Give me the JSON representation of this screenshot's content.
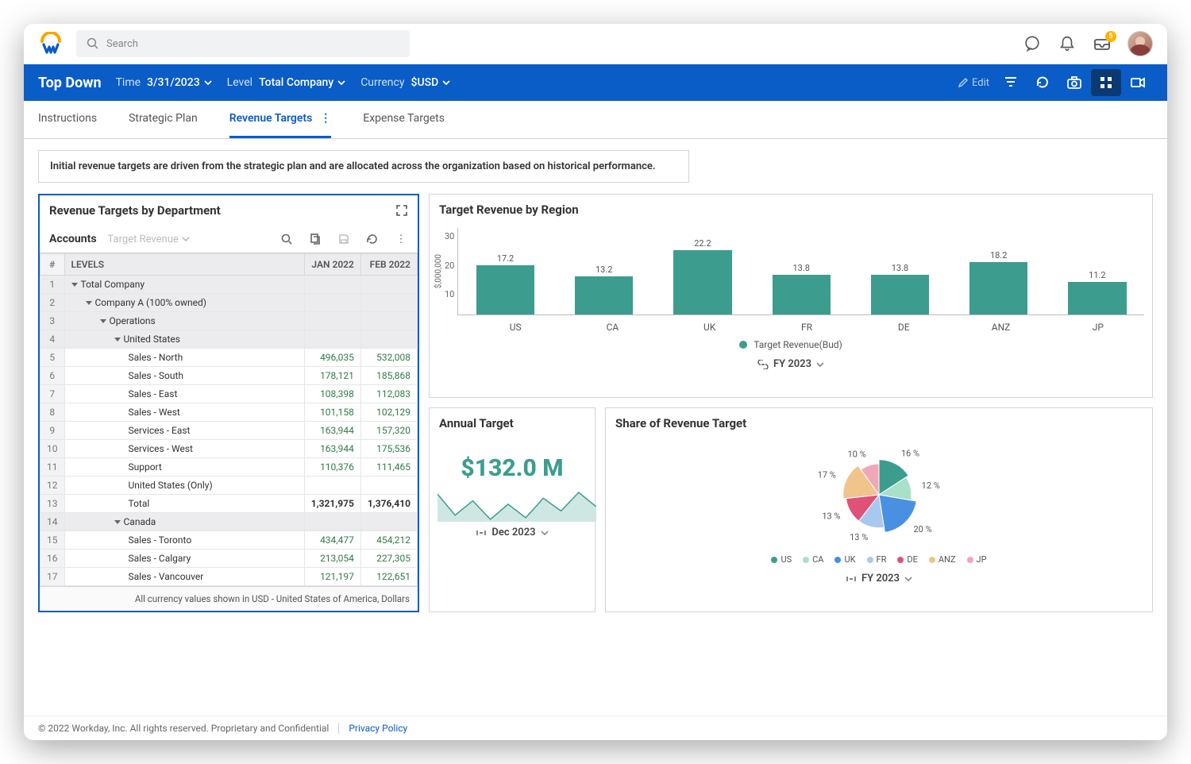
{
  "search_placeholder": "Search",
  "inbox_badge": "5",
  "bluebar": {
    "title": "Top Down",
    "time_label": "Time",
    "time_value": "3/31/2023",
    "level_label": "Level",
    "level_value": "Total Company",
    "currency_label": "Currency",
    "currency_value": "$USD",
    "edit_label": "Edit"
  },
  "tabs": {
    "instructions": "Instructions",
    "strategic_plan": "Strategic Plan",
    "revenue_targets": "Revenue Targets",
    "expense_targets": "Expense Targets"
  },
  "banner": "Initial revenue targets are driven from the strategic plan and are allocated across the organization based on historical performance.",
  "table": {
    "title": "Revenue Targets by Department",
    "accounts_label": "Accounts",
    "select_label": "Target Revenue",
    "col_num": "#",
    "col_levels": "LEVELS",
    "col_jan": "JAN 2022",
    "col_feb": "FEB 2022",
    "rows": [
      {
        "n": "1",
        "level": "Total Company",
        "indent": 0,
        "exp": true,
        "grey": true,
        "jan": "",
        "feb": ""
      },
      {
        "n": "2",
        "level": "Company A (100% owned)",
        "indent": 1,
        "exp": true,
        "grey": true,
        "jan": "",
        "feb": ""
      },
      {
        "n": "3",
        "level": "Operations",
        "indent": 2,
        "exp": true,
        "grey": true,
        "jan": "",
        "feb": ""
      },
      {
        "n": "4",
        "level": "United States",
        "indent": 3,
        "exp": true,
        "grey": true,
        "jan": "",
        "feb": ""
      },
      {
        "n": "5",
        "level": "Sales - North",
        "indent": 4,
        "jan": "496,035",
        "feb": "532,008"
      },
      {
        "n": "6",
        "level": "Sales - South",
        "indent": 4,
        "jan": "178,121",
        "feb": "185,868"
      },
      {
        "n": "7",
        "level": "Sales - East",
        "indent": 4,
        "jan": "108,398",
        "feb": "112,083"
      },
      {
        "n": "8",
        "level": "Sales - West",
        "indent": 4,
        "jan": "101,158",
        "feb": "102,129"
      },
      {
        "n": "9",
        "level": "Services - East",
        "indent": 4,
        "jan": "163,944",
        "feb": "157,320"
      },
      {
        "n": "10",
        "level": "Services - West",
        "indent": 4,
        "jan": "163,944",
        "feb": "175,536"
      },
      {
        "n": "11",
        "level": "Support",
        "indent": 4,
        "jan": "110,376",
        "feb": "111,465"
      },
      {
        "n": "12",
        "level": "United States (Only)",
        "indent": 4,
        "jan": "",
        "feb": ""
      },
      {
        "n": "13",
        "level": "Total",
        "indent": 4,
        "jan": "1,321,975",
        "feb": "1,376,410",
        "bold": true
      },
      {
        "n": "14",
        "level": "Canada",
        "indent": 3,
        "exp": true,
        "grey": true,
        "jan": "",
        "feb": ""
      },
      {
        "n": "15",
        "level": "Sales - Toronto",
        "indent": 4,
        "jan": "434,477",
        "feb": "454,212"
      },
      {
        "n": "16",
        "level": "Sales - Calgary",
        "indent": 4,
        "jan": "213,054",
        "feb": "227,305"
      },
      {
        "n": "17",
        "level": "Sales - Vancouver",
        "indent": 4,
        "jan": "121,197",
        "feb": "122,651"
      }
    ],
    "footer": "All currency values shown in USD - United States of America, Dollars"
  },
  "bar_card": {
    "title": "Target Revenue by Region",
    "y_title": "$,000,000",
    "legend": "Target Revenue(Bud)",
    "period": "FY 2023"
  },
  "annual": {
    "title": "Annual Target",
    "value": "$132.0 M",
    "period": "Dec 2023"
  },
  "pie_card": {
    "title": "Share of Revenue Target",
    "period": "FY 2023"
  },
  "footer": {
    "copyright": "© 2022 Workday, Inc. All rights reserved. Proprietary and Confidential",
    "privacy": "Privacy Policy"
  },
  "chart_data": [
    {
      "type": "bar",
      "title": "Target Revenue by Region",
      "ylabel": "$,000,000",
      "ylim": [
        0,
        30
      ],
      "yticks": [
        10,
        20,
        30
      ],
      "categories": [
        "US",
        "CA",
        "UK",
        "FR",
        "DE",
        "ANZ",
        "JP"
      ],
      "series": [
        {
          "name": "Target Revenue(Bud)",
          "values": [
            17.2,
            13.2,
            22.2,
            13.8,
            13.8,
            18.2,
            11.2
          ]
        }
      ],
      "period": "FY 2023"
    },
    {
      "type": "kpi",
      "title": "Annual Target",
      "value": 132.0,
      "unit": "$M",
      "period": "Dec 2023",
      "sparkline": [
        80,
        55,
        72,
        50,
        68,
        52,
        75,
        60,
        82,
        65
      ]
    },
    {
      "type": "pie",
      "title": "Share of Revenue Target",
      "categories": [
        "US",
        "CA",
        "UK",
        "FR",
        "DE",
        "ANZ",
        "JP"
      ],
      "values": [
        16,
        12,
        20,
        13,
        13,
        17,
        10
      ],
      "colors": [
        "#3c9d8f",
        "#a8e0c9",
        "#4a90e2",
        "#a8c8f0",
        "#e0517a",
        "#f0c48a",
        "#f2a7b8"
      ],
      "period": "FY 2023"
    }
  ]
}
